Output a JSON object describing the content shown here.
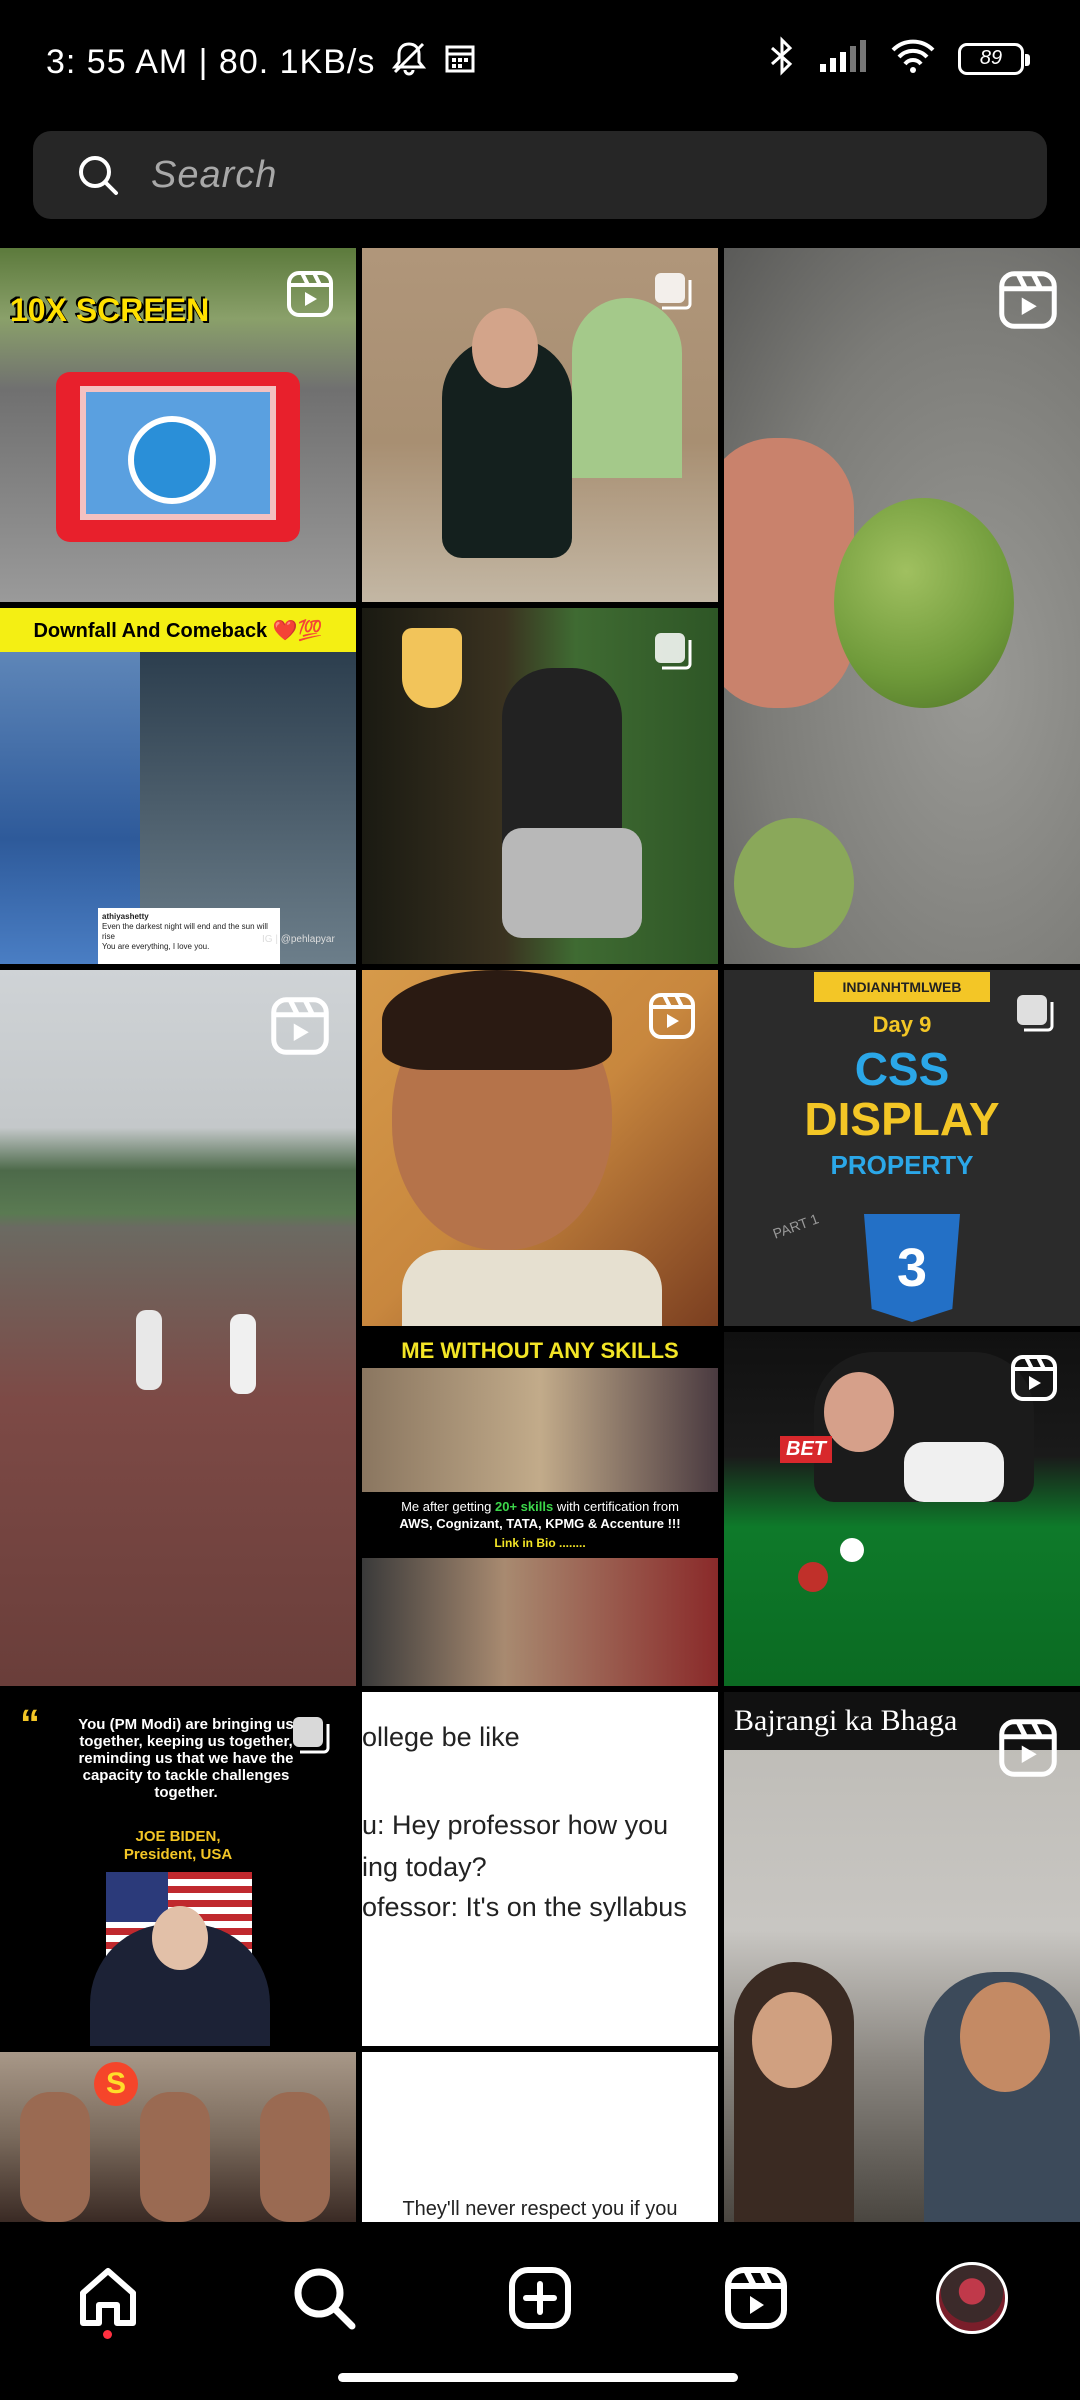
{
  "status_bar": {
    "time_speed": "3: 55 AM | 80. 1KB/s",
    "battery": "89",
    "icons": [
      "mute-icon",
      "calendar-icon",
      "bluetooth-icon",
      "signal-icon",
      "wifi-icon",
      "battery-icon"
    ]
  },
  "search": {
    "placeholder": "Search"
  },
  "tiles": {
    "t1": {
      "label": "10X SCREEN",
      "kind": "reel"
    },
    "t2": {
      "kind": "carousel"
    },
    "t3": {
      "kind": "reel"
    },
    "t4": {
      "label": "Downfall And Comeback ❤️💯",
      "caption_user": "athiyashetty",
      "caption_text": "Even the darkest night will end and the sun will rise",
      "caption_reply": "You are everything, I love you.",
      "tag": "IG | @pehlapyar",
      "kind": "post"
    },
    "t5": {
      "kind": "carousel"
    },
    "t6": {
      "kind": "reel"
    },
    "t7": {
      "kind": "reel"
    },
    "t8": {
      "brand": "INDIANHTMLWEB",
      "day": "Day 9",
      "line1": "CSS",
      "line2": "DISPLAY",
      "line3": "PROPERTY",
      "part": "PART 1",
      "badge": "3",
      "kind": "carousel"
    },
    "t9": {
      "title": "ME WITHOUT ANY SKILLS",
      "body_pre": "Me after getting ",
      "body_hl": "20+ skills",
      "body_post": " with certification from",
      "companies": "AWS, Cognizant, TATA, KPMG & Accenture !!!",
      "link": "Link in Bio ........",
      "kind": "post"
    },
    "t10": {
      "kind": "reel",
      "sponsor": "BET"
    },
    "t11": {
      "quote": "You (PM Modi) are bringing us together, keeping us together, reminding us that we have the capacity to tackle challenges together.",
      "author": "JOE BIDEN,",
      "role": "President, USA",
      "kind": "carousel"
    },
    "t12": {
      "line1": "ollege be like",
      "line2": "u: Hey professor how you",
      "line3": "ing today?",
      "line4": "ofessor: It's on the syllabus",
      "kind": "post"
    },
    "t13": {
      "label": "Bajrangi ka Bhaga",
      "kind": "reel"
    },
    "t14": {
      "kind": "post"
    },
    "t15": {
      "text": "They'll never respect you if you",
      "kind": "post"
    }
  },
  "nav": {
    "items": [
      "home-icon",
      "search-icon",
      "create-icon",
      "reels-icon",
      "profile-avatar"
    ]
  },
  "colors": {
    "background": "#000000",
    "search_bg": "#262626",
    "notification_dot": "#ff3040"
  }
}
